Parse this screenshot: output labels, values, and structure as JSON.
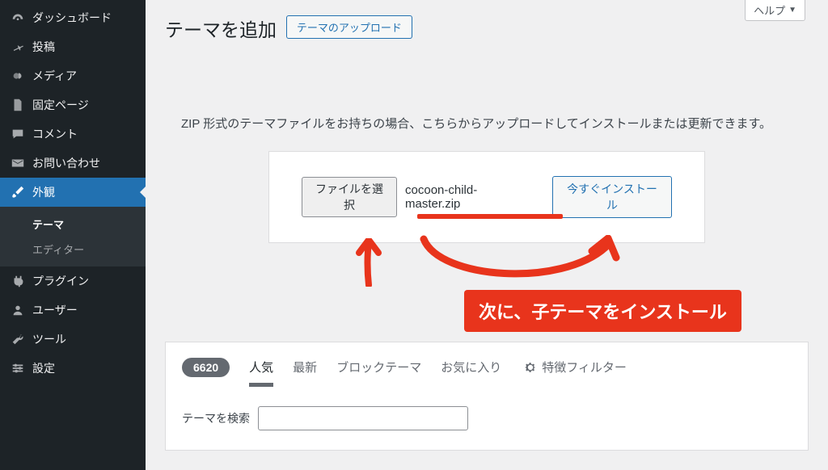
{
  "sidebar": {
    "items": [
      {
        "icon": "dashboard",
        "label": "ダッシュボード"
      },
      {
        "icon": "pin",
        "label": "投稿"
      },
      {
        "icon": "media",
        "label": "メディア"
      },
      {
        "icon": "page",
        "label": "固定ページ"
      },
      {
        "icon": "comment",
        "label": "コメント"
      },
      {
        "icon": "mail",
        "label": "お問い合わせ"
      },
      {
        "icon": "brush",
        "label": "外観",
        "current": true
      },
      {
        "icon": "plug",
        "label": "プラグイン"
      },
      {
        "icon": "user",
        "label": "ユーザー"
      },
      {
        "icon": "wrench",
        "label": "ツール"
      },
      {
        "icon": "settings",
        "label": "設定"
      }
    ],
    "submenu": [
      {
        "label": "テーマ",
        "current": true
      },
      {
        "label": "エディター",
        "current": false
      }
    ]
  },
  "help_tab": "ヘルプ",
  "page_title": "テーマを追加",
  "upload_button": "テーマのアップロード",
  "instruction": "ZIP 形式のテーマファイルをお持ちの場合、こちらからアップロードしてインストールまたは更新できます。",
  "upload_box": {
    "choose_file": "ファイルを選択",
    "filename": "cocoon-child-master.zip",
    "install_now": "今すぐインストール"
  },
  "annotation": {
    "text": "次に、子テーマをインストール"
  },
  "filter": {
    "count": "6620",
    "tabs": {
      "popular": "人気",
      "latest": "最新",
      "block": "ブロックテーマ",
      "favorites": "お気に入り",
      "feature_filter": "特徴フィルター"
    },
    "search_label": "テーマを検索",
    "search_placeholder": ""
  }
}
